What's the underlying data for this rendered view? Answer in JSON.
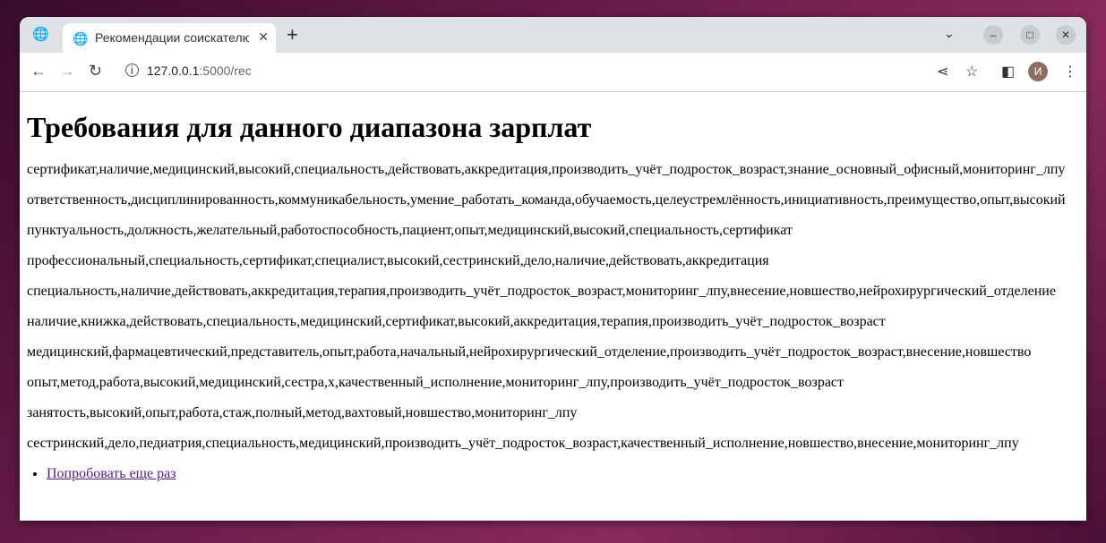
{
  "browser": {
    "tab_title": "Рекомендации соискателю",
    "url_host": "127.0.0.1",
    "url_path": ":5000/rec",
    "avatar_letter": "И"
  },
  "page": {
    "heading": "Требования для данного диапазона зарплат",
    "lines": [
      "сертификат,наличие,медицинский,высокий,специальность,действовать,аккредитация,производить_учёт_подросток_возраст,знание_основный_офисный,мониторинг_лпу",
      "ответственность,дисциплинированность,коммуникабельность,умение_работать_команда,обучаемость,целеустремлённость,инициативность,преимущество,опыт,высокий",
      "пунктуальность,должность,желательный,работоспособность,пациент,опыт,медицинский,высокий,специальность,сертификат",
      "профессиональный,специальность,сертификат,специалист,высокий,сестринский,дело,наличие,действовать,аккредитация",
      "специальность,наличие,действовать,аккредитация,терапия,производить_учёт_подросток_возраст,мониторинг_лпу,внесение,новшество,нейрохирургический_отделение",
      "наличие,книжка,действовать,специальность,медицинский,сертификат,высокий,аккредитация,терапия,производить_учёт_подросток_возраст",
      "медицинский,фармацевтический,представитель,опыт,работа,начальный,нейрохирургический_отделение,производить_учёт_подросток_возраст,внесение,новшество",
      "опыт,метод,работа,высокий,медицинский,сестра,х,качественный_исполнение,мониторинг_лпу,производить_учёт_подросток_возраст",
      "занятость,высокий,опыт,работа,стаж,полный,метод,вахтовый,новшество,мониторинг_лпу",
      "сестринский,дело,педиатрия,специальность,медицинский,производить_учёт_подросток_возраст,качественный_исполнение,новшество,внесение,мониторинг_лпу"
    ],
    "retry_link": "Попробовать еще раз"
  }
}
